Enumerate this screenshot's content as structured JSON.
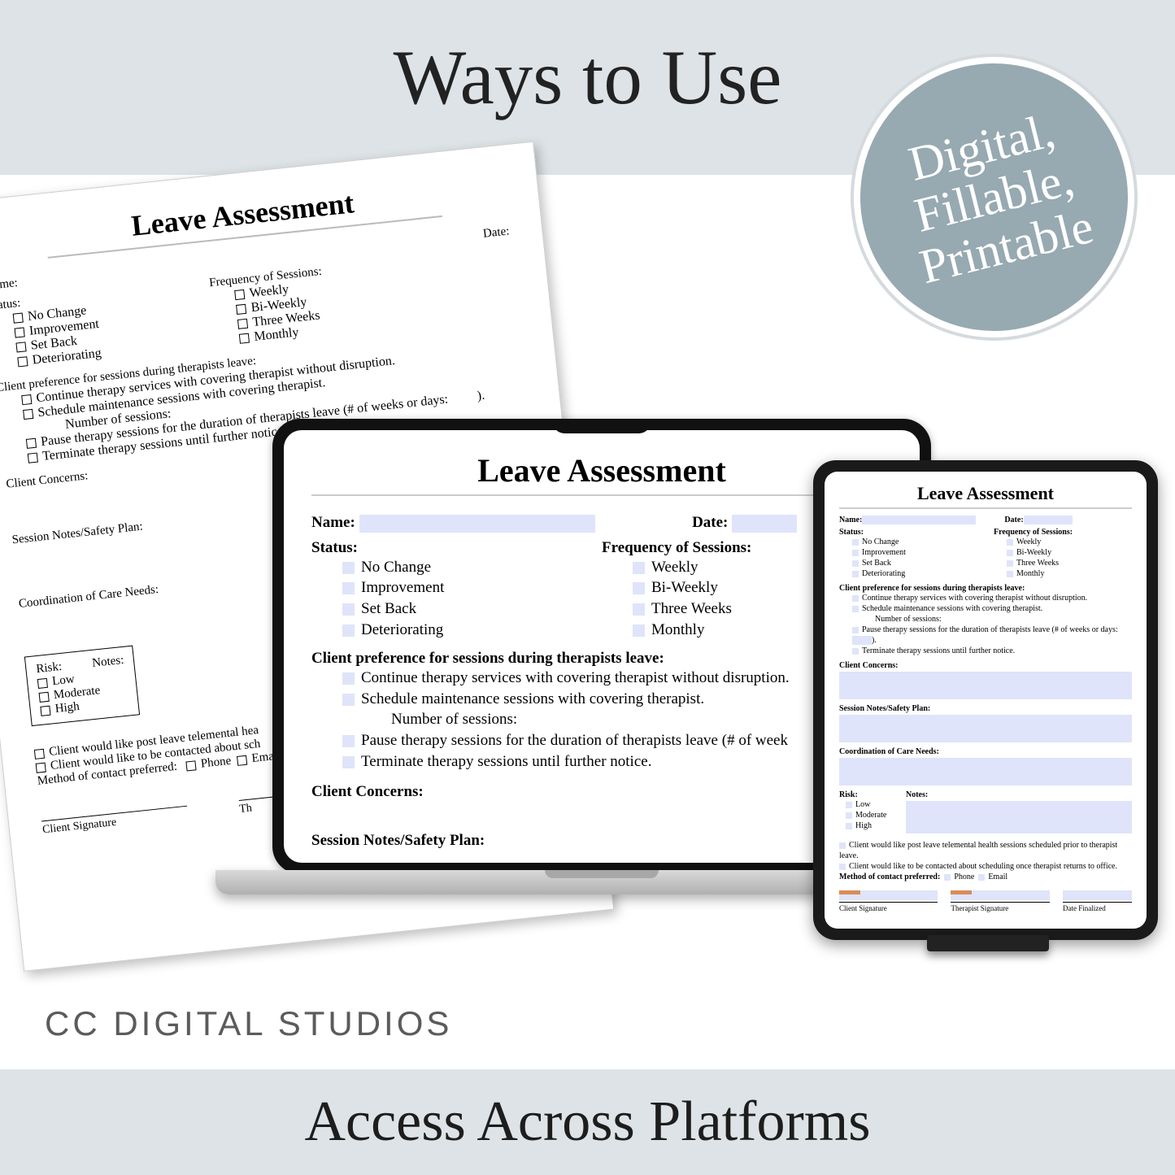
{
  "headline": "Ways to Use",
  "badge": {
    "l1": "Digital,",
    "l2": "Fillable,",
    "l3": "Printable"
  },
  "brand": "CC DIGITAL STUDIOS",
  "tagline": "Access Across Platforms",
  "form": {
    "title": "Leave Assessment",
    "fields": {
      "name": "Name:",
      "date": "Date:",
      "status": "Status:",
      "freq": "Frequency of Sessions:",
      "pref": "Client preference for sessions during therapists leave:",
      "concerns": "Client Concerns:",
      "notes_safety": "Session Notes/Safety Plan:",
      "coord": "Coordination of Care Needs:",
      "risk": "Risk:",
      "notes": "Notes:",
      "method": "Method of contact preferred:",
      "phone": "Phone",
      "email": "Email",
      "num_sessions": "Number of sessions:"
    },
    "status_opts": [
      "No Change",
      "Improvement",
      "Set Back",
      "Deteriorating"
    ],
    "freq_opts": [
      "Weekly",
      "Bi-Weekly",
      "Three Weeks",
      "Monthly"
    ],
    "pref_opts": {
      "cont": "Continue therapy services with covering therapist without disruption.",
      "sched": "Schedule maintenance sessions with covering therapist.",
      "pause_full": "Pause therapy sessions for the duration of therapists leave (# of weeks or days:",
      "pause_short": "Pause therapy sessions for the duration of therapists leave (# of week",
      "term": "Terminate therapy sessions until further notice."
    },
    "risk_opts": [
      "Low",
      "Moderate",
      "High"
    ],
    "contact_lines": {
      "post_full": "Client would like post leave telemental health sessions scheduled prior to therapist leave.",
      "post_trunc": "Client would like post leave telemental hea",
      "sched_full": "Client would like to be contacted about scheduling once therapist returns to office.",
      "sched_trunc": "Client would like to be contacted about sch"
    },
    "sig": {
      "client": "Client Signature",
      "therapist": "Therapist  Signature",
      "date": "Date Finalized",
      "th_short": "Th"
    },
    "close_paren": ")."
  }
}
